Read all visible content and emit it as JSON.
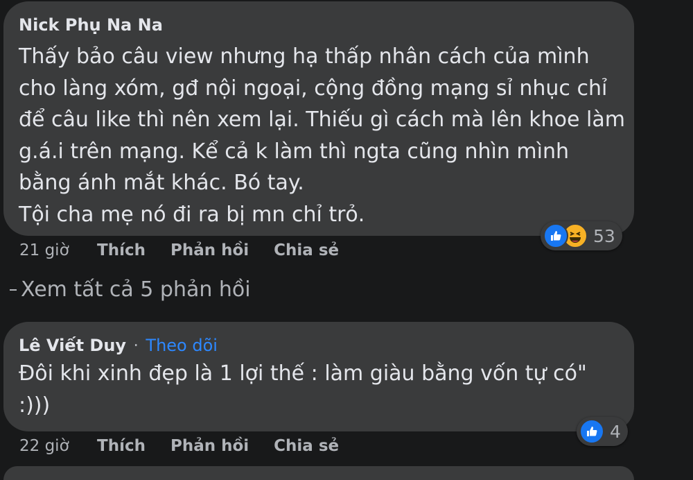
{
  "comments": [
    {
      "author": "Nick Phụ Na Na",
      "text": "Thấy bảo câu view nhưng hạ thấp nhân cách của mình\ncho làng xóm, gđ nội ngoại, cộng đồng mạng sỉ nhục chỉ\nđể câu like thì nên xem lại. Thiếu gì cách mà lên khoe làm\ng.á.i trên mạng. Kể cả k làm thì ngta cũng nhìn mình\nbằng ánh mắt khác. Bó tay.\nTội cha mẹ nó đi ra bị mn chỉ trỏ.",
      "reaction_count": "53",
      "reaction_icons": [
        "like-icon",
        "haha-icon"
      ],
      "time": "21 giờ",
      "like": "Thích",
      "reply": "Phản hồi",
      "share": "Chia sẻ"
    },
    {
      "author": "Lê Viết Duy",
      "separator": "·",
      "follow": "Theo dõi",
      "text": "Đôi khi xinh đẹp là 1 lợi thế : làm giàu bằng vốn tự có\"\n:)))",
      "reaction_count": "4",
      "reaction_icons": [
        "like-icon"
      ],
      "time": "22 giờ",
      "like": "Thích",
      "reply": "Phản hồi",
      "share": "Chia sẻ"
    }
  ],
  "view_replies": "Xem tất cả 5 phản hồi",
  "colors": {
    "background": "#18191a",
    "bubble": "#3a3b3c",
    "text": "#e4e6eb",
    "secondary": "#b0b3b8",
    "link": "#2d88ff",
    "like": "#1877f2",
    "haha": "#f7b125"
  }
}
